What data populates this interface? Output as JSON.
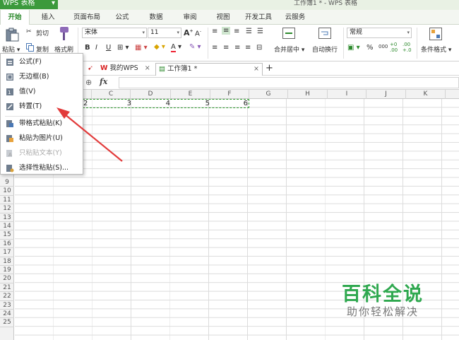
{
  "title_bar": {
    "app_button": "WPS 表格",
    "window_title": "工作簿1 * - WPS 表格"
  },
  "menu_tabs": [
    "开始",
    "插入",
    "页面布局",
    "公式",
    "数据",
    "审阅",
    "视图",
    "开发工具",
    "云服务"
  ],
  "toolbar": {
    "paste": "粘贴",
    "cut": "剪切",
    "copy": "复制",
    "format_painter": "格式刷",
    "font_name": "宋体",
    "font_size": "11",
    "bold": "B",
    "italic": "I",
    "underline": "U",
    "merge_center": "合并居中",
    "wrap_text": "自动换行",
    "number_format": "常规",
    "percent": "%",
    "thousands": "000",
    "dec_inc": "+.0\n.00",
    "cond_format": "条件格式"
  },
  "doc_tabs": {
    "home": "我的WPS",
    "workbook": "工作簿1 *",
    "add": "+"
  },
  "formula_bar": {
    "fx": "fx"
  },
  "columns": [
    "C",
    "D",
    "E",
    "F",
    "G",
    "H",
    "I",
    "J",
    "K"
  ],
  "rows": [
    "9",
    "10",
    "11",
    "12",
    "13",
    "14",
    "15",
    "16",
    "17",
    "18",
    "19",
    "20",
    "21",
    "22",
    "23",
    "24",
    "25"
  ],
  "cells": [
    "2",
    "3",
    "4",
    "5",
    "6"
  ],
  "paste_menu": [
    {
      "label": "公式(F)",
      "icon": "paste-formula-icon",
      "enabled": true
    },
    {
      "label": "无边框(B)",
      "icon": "paste-no-border-icon",
      "enabled": true
    },
    {
      "label": "值(V)",
      "icon": "paste-values-icon",
      "enabled": true
    },
    {
      "label": "转置(T)",
      "icon": "paste-transpose-icon",
      "enabled": true
    },
    {
      "label": "带格式粘贴(K)",
      "icon": "paste-with-format-icon",
      "enabled": true
    },
    {
      "label": "粘贴为图片(U)",
      "icon": "paste-as-picture-icon",
      "enabled": true
    },
    {
      "label": "只粘贴文本(Y)",
      "icon": "paste-text-only-icon",
      "enabled": false
    },
    {
      "label": "选择性粘贴(S)...",
      "icon": "paste-special-icon",
      "enabled": true
    }
  ],
  "watermark": {
    "title": "百科全说",
    "subtitle": "助你轻松解决"
  },
  "colors": {
    "accent": "#2d8a2d",
    "arrow": "#e23b3b",
    "marquee": "#2e9a2e",
    "watermark": "#2fa84f"
  }
}
